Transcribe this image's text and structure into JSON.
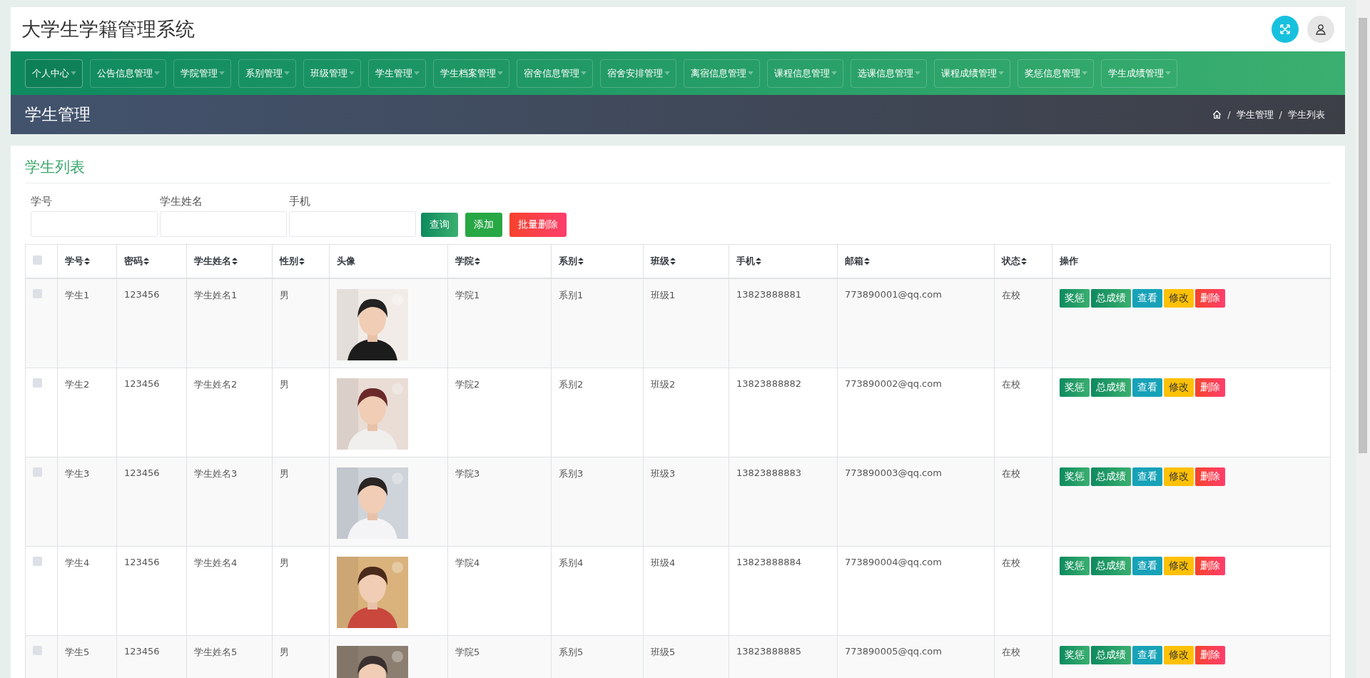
{
  "header": {
    "title": "大学生学籍管理系统"
  },
  "nav": [
    {
      "label": "个人中心",
      "selected": true
    },
    {
      "label": "公告信息管理",
      "selected": false
    },
    {
      "label": "学院管理",
      "selected": false
    },
    {
      "label": "系别管理",
      "selected": false
    },
    {
      "label": "班级管理",
      "selected": false
    },
    {
      "label": "学生管理",
      "selected": false
    },
    {
      "label": "学生档案管理",
      "selected": false
    },
    {
      "label": "宿舍信息管理",
      "selected": false
    },
    {
      "label": "宿舍安排管理",
      "selected": false
    },
    {
      "label": "离宿信息管理",
      "selected": false
    },
    {
      "label": "课程信息管理",
      "selected": false
    },
    {
      "label": "选课信息管理",
      "selected": false
    },
    {
      "label": "课程成绩管理",
      "selected": false
    },
    {
      "label": "奖惩信息管理",
      "selected": false
    },
    {
      "label": "学生成绩管理",
      "selected": false
    }
  ],
  "page_heading": "学生管理",
  "breadcrumb": [
    {
      "kind": "separator",
      "text": "/"
    },
    {
      "kind": "link",
      "text": "学生管理"
    },
    {
      "kind": "separator",
      "text": "/"
    },
    {
      "kind": "current",
      "text": "学生列表"
    }
  ],
  "card_title": "学生列表",
  "filters": [
    {
      "label": "学号"
    },
    {
      "label": "学生姓名"
    },
    {
      "label": "手机"
    }
  ],
  "filter_buttons": [
    {
      "label": "查询",
      "kind": "search"
    },
    {
      "label": "添加",
      "kind": "add"
    },
    {
      "label": "批量删除",
      "kind": "delete"
    }
  ],
  "table": {
    "columns": [
      {
        "label": "学号",
        "sortable": true
      },
      {
        "label": "密码",
        "sortable": true
      },
      {
        "label": "学生姓名",
        "sortable": true
      },
      {
        "label": "性别",
        "sortable": true
      },
      {
        "label": "头像",
        "sortable": false
      },
      {
        "label": "学院",
        "sortable": true
      },
      {
        "label": "系别",
        "sortable": true
      },
      {
        "label": "班级",
        "sortable": true
      },
      {
        "label": "手机",
        "sortable": true
      },
      {
        "label": "邮箱",
        "sortable": true
      },
      {
        "label": "状态",
        "sortable": true
      },
      {
        "label": "操作",
        "sortable": false
      }
    ],
    "header_checked": false,
    "rows": [
      {
        "checked": false,
        "cells": [
          "学生1",
          "123456",
          "学生姓名1",
          "男",
          {
            "kind": "picture"
          },
          "学院1",
          "系别1",
          "班级1",
          "13823888881",
          "773890001@qq.com",
          "在校"
        ],
        "actions": [
          {
            "label": "奖惩",
            "kind": "reward"
          },
          {
            "label": "总成绩",
            "kind": "score"
          },
          {
            "label": "查看",
            "kind": "view"
          },
          {
            "label": "修改",
            "kind": "edit"
          },
          {
            "label": "删除",
            "kind": "delete"
          }
        ]
      },
      {
        "checked": false,
        "cells": [
          "学生2",
          "123456",
          "学生姓名2",
          "男",
          {
            "kind": "picture"
          },
          "学院2",
          "系别2",
          "班级2",
          "13823888882",
          "773890002@qq.com",
          "在校"
        ],
        "actions": [
          {
            "label": "奖惩",
            "kind": "reward"
          },
          {
            "label": "总成绩",
            "kind": "score"
          },
          {
            "label": "查看",
            "kind": "view"
          },
          {
            "label": "修改",
            "kind": "edit"
          },
          {
            "label": "删除",
            "kind": "delete"
          }
        ]
      },
      {
        "checked": false,
        "cells": [
          "学生3",
          "123456",
          "学生姓名3",
          "男",
          {
            "kind": "picture"
          },
          "学院3",
          "系别3",
          "班级3",
          "13823888883",
          "773890003@qq.com",
          "在校"
        ],
        "actions": [
          {
            "label": "奖惩",
            "kind": "reward"
          },
          {
            "label": "总成绩",
            "kind": "score"
          },
          {
            "label": "查看",
            "kind": "view"
          },
          {
            "label": "修改",
            "kind": "edit"
          },
          {
            "label": "删除",
            "kind": "delete"
          }
        ]
      },
      {
        "checked": false,
        "cells": [
          "学生4",
          "123456",
          "学生姓名4",
          "男",
          {
            "kind": "picture"
          },
          "学院4",
          "系别4",
          "班级4",
          "13823888884",
          "773890004@qq.com",
          "在校"
        ],
        "actions": [
          {
            "label": "奖惩",
            "kind": "reward"
          },
          {
            "label": "总成绩",
            "kind": "score"
          },
          {
            "label": "查看",
            "kind": "view"
          },
          {
            "label": "修改",
            "kind": "edit"
          },
          {
            "label": "删除",
            "kind": "delete"
          }
        ]
      },
      {
        "checked": false,
        "cells": [
          "学生5",
          "123456",
          "学生姓名5",
          "男",
          {
            "kind": "picture"
          },
          "学院5",
          "系别5",
          "班级5",
          "13823888885",
          "773890005@qq.com",
          "在校"
        ],
        "actions": [
          {
            "label": "奖惩",
            "kind": "reward"
          },
          {
            "label": "总成绩",
            "kind": "score"
          },
          {
            "label": "查看",
            "kind": "view"
          },
          {
            "label": "修改",
            "kind": "edit"
          },
          {
            "label": "删除",
            "kind": "delete"
          }
        ]
      }
    ]
  }
}
